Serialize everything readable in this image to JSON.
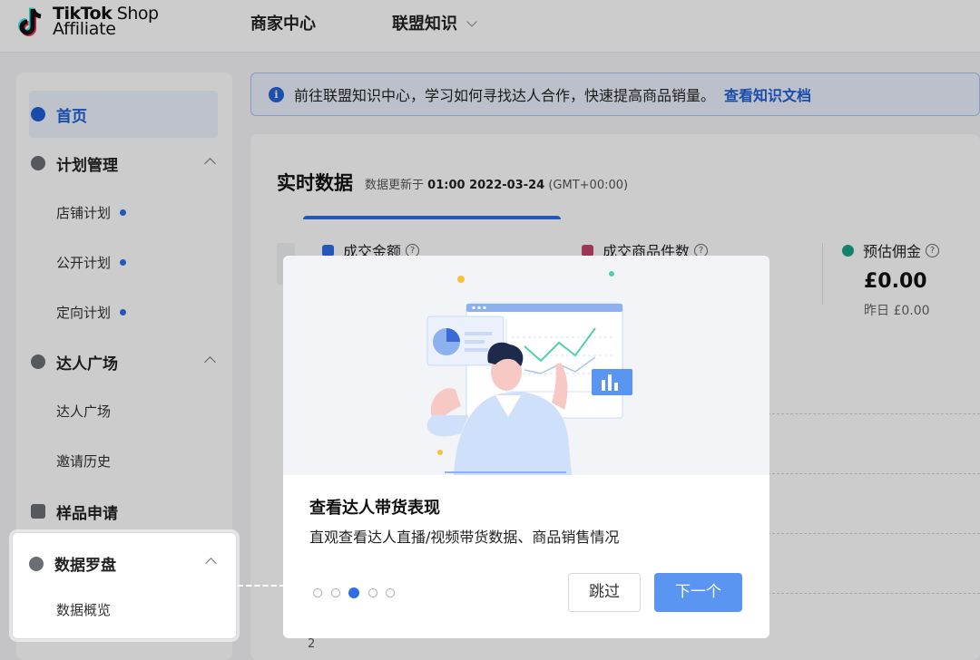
{
  "logo": {
    "line1_bold": "TikTok",
    "line1_rest": " Shop",
    "line2": "Affiliate"
  },
  "topnav": {
    "seller_center": "商家中心",
    "affiliate_knowledge": "联盟知识"
  },
  "sidebar": {
    "home": "首页",
    "plan_mgmt": "计划管理",
    "plan_items": [
      "店铺计划",
      "公开计划",
      "定向计划"
    ],
    "creator_square": "达人广场",
    "creator_items": [
      "达人广场",
      "邀请历史"
    ],
    "sample_request": "样品申请",
    "data_compass": "数据罗盘",
    "data_items": [
      "数据概览"
    ]
  },
  "banner": {
    "text": "前往联盟知识中心，学习如何寻找达人合作，快速提高商品销量。",
    "link": "查看知识文档"
  },
  "realtime": {
    "title": "实时数据",
    "updated_prefix": "数据更新于",
    "updated_time": "01:00 2022-03-24",
    "timezone": "(GMT+00:00)",
    "metrics": {
      "gmv_label": "成交金额",
      "items_sold_label": "成交商品件数",
      "commission_label": "预估佣金",
      "commission_value": "£0.00",
      "commission_yesterday": "昨日 £0.00"
    },
    "axis_tick": "2"
  },
  "modal": {
    "title": "查看达人带货表现",
    "description": "直观查看达人直播/视频带货数据、商品销售情况",
    "steps_total": 5,
    "step_current": 3,
    "skip_label": "跳过",
    "next_label": "下一个"
  },
  "colors": {
    "brand_blue": "#2e6fe6",
    "next_button": "#5a96f1",
    "banner_bg": "#eaf1fd"
  }
}
